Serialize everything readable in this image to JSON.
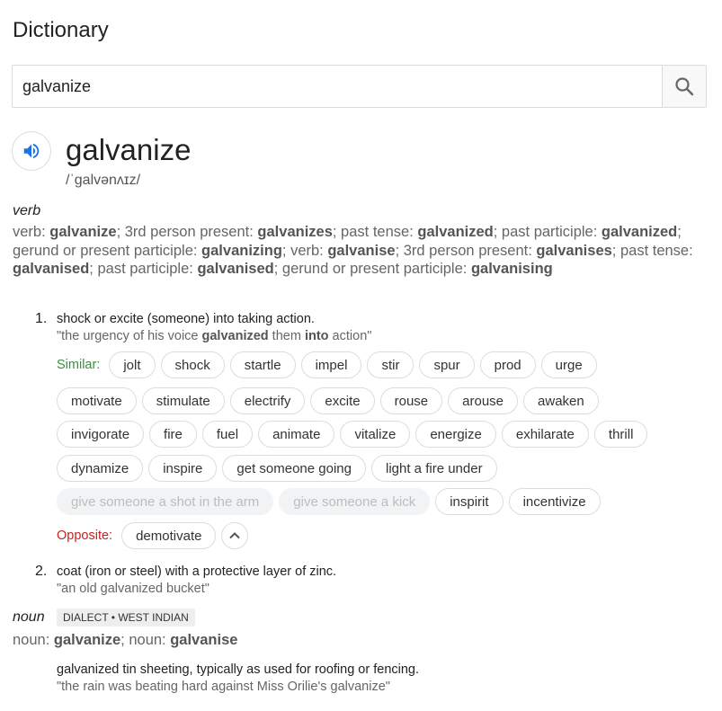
{
  "title": "Dictionary",
  "search": {
    "value": "galvanize",
    "icon": "search-icon"
  },
  "entry": {
    "word": "galvanize",
    "phonetic": "/ˈɡalvənʌɪz/",
    "audio_icon": "speaker-icon",
    "accent_color": "#1a73e8"
  },
  "verb": {
    "pos": "verb",
    "forms": [
      {
        "t": "verb: "
      },
      {
        "b": "galvanize"
      },
      {
        "t": "; 3rd person present: "
      },
      {
        "b": "galvanizes"
      },
      {
        "t": "; past tense: "
      },
      {
        "b": "galvanized"
      },
      {
        "t": "; past participle: "
      },
      {
        "b": "galvanized"
      },
      {
        "t": "; gerund or present participle: "
      },
      {
        "b": "galvanizing"
      },
      {
        "t": "; verb: "
      },
      {
        "b": "galvanise"
      },
      {
        "t": "; 3rd person present: "
      },
      {
        "b": "galvanises"
      },
      {
        "t": "; past tense: "
      },
      {
        "b": "galvanised"
      },
      {
        "t": "; past participle: "
      },
      {
        "b": "galvanised"
      },
      {
        "t": "; gerund or present participle: "
      },
      {
        "b": "galvanising"
      }
    ],
    "senses": [
      {
        "number": "1.",
        "definition": "shock or excite (someone) into taking action.",
        "example": [
          {
            "t": "\"the urgency of his voice "
          },
          {
            "b": "galvanized"
          },
          {
            "t": " them "
          },
          {
            "b": "into"
          },
          {
            "t": " action\""
          }
        ],
        "similar_label": "Similar:",
        "similar": [
          [
            "jolt",
            "shock",
            "startle",
            "impel",
            "stir",
            "spur",
            "prod",
            "urge"
          ],
          [
            "motivate",
            "stimulate",
            "electrify",
            "excite",
            "rouse",
            "arouse",
            "awaken"
          ],
          [
            "invigorate",
            "fire",
            "fuel",
            "animate",
            "vitalize",
            "energize",
            "exhilarate",
            "thrill"
          ],
          [
            "dynamize",
            "inspire",
            "get someone going",
            "light a fire under"
          ]
        ],
        "similar_faded": [
          "give someone a shot in the arm",
          "give someone a kick"
        ],
        "similar_last": [
          "inspirit",
          "incentivize"
        ],
        "opposite_label": "Opposite:",
        "opposite": [
          "demotivate"
        ],
        "similar_color": "#3c8c40",
        "opposite_color": "#c5221f"
      },
      {
        "number": "2.",
        "definition": "coat (iron or steel) with a protective layer of zinc.",
        "example_text": "\"an old galvanized bucket\""
      }
    ]
  },
  "noun": {
    "pos": "noun",
    "dialect": "DIALECT • WEST INDIAN",
    "forms": [
      {
        "t": "noun: "
      },
      {
        "b": "galvanize"
      },
      {
        "t": "; noun: "
      },
      {
        "b": "galvanise"
      }
    ],
    "definition": "galvanized tin sheeting, typically as used for roofing or fencing.",
    "example": "\"the rain was beating hard against Miss Orilie's galvanize\""
  }
}
